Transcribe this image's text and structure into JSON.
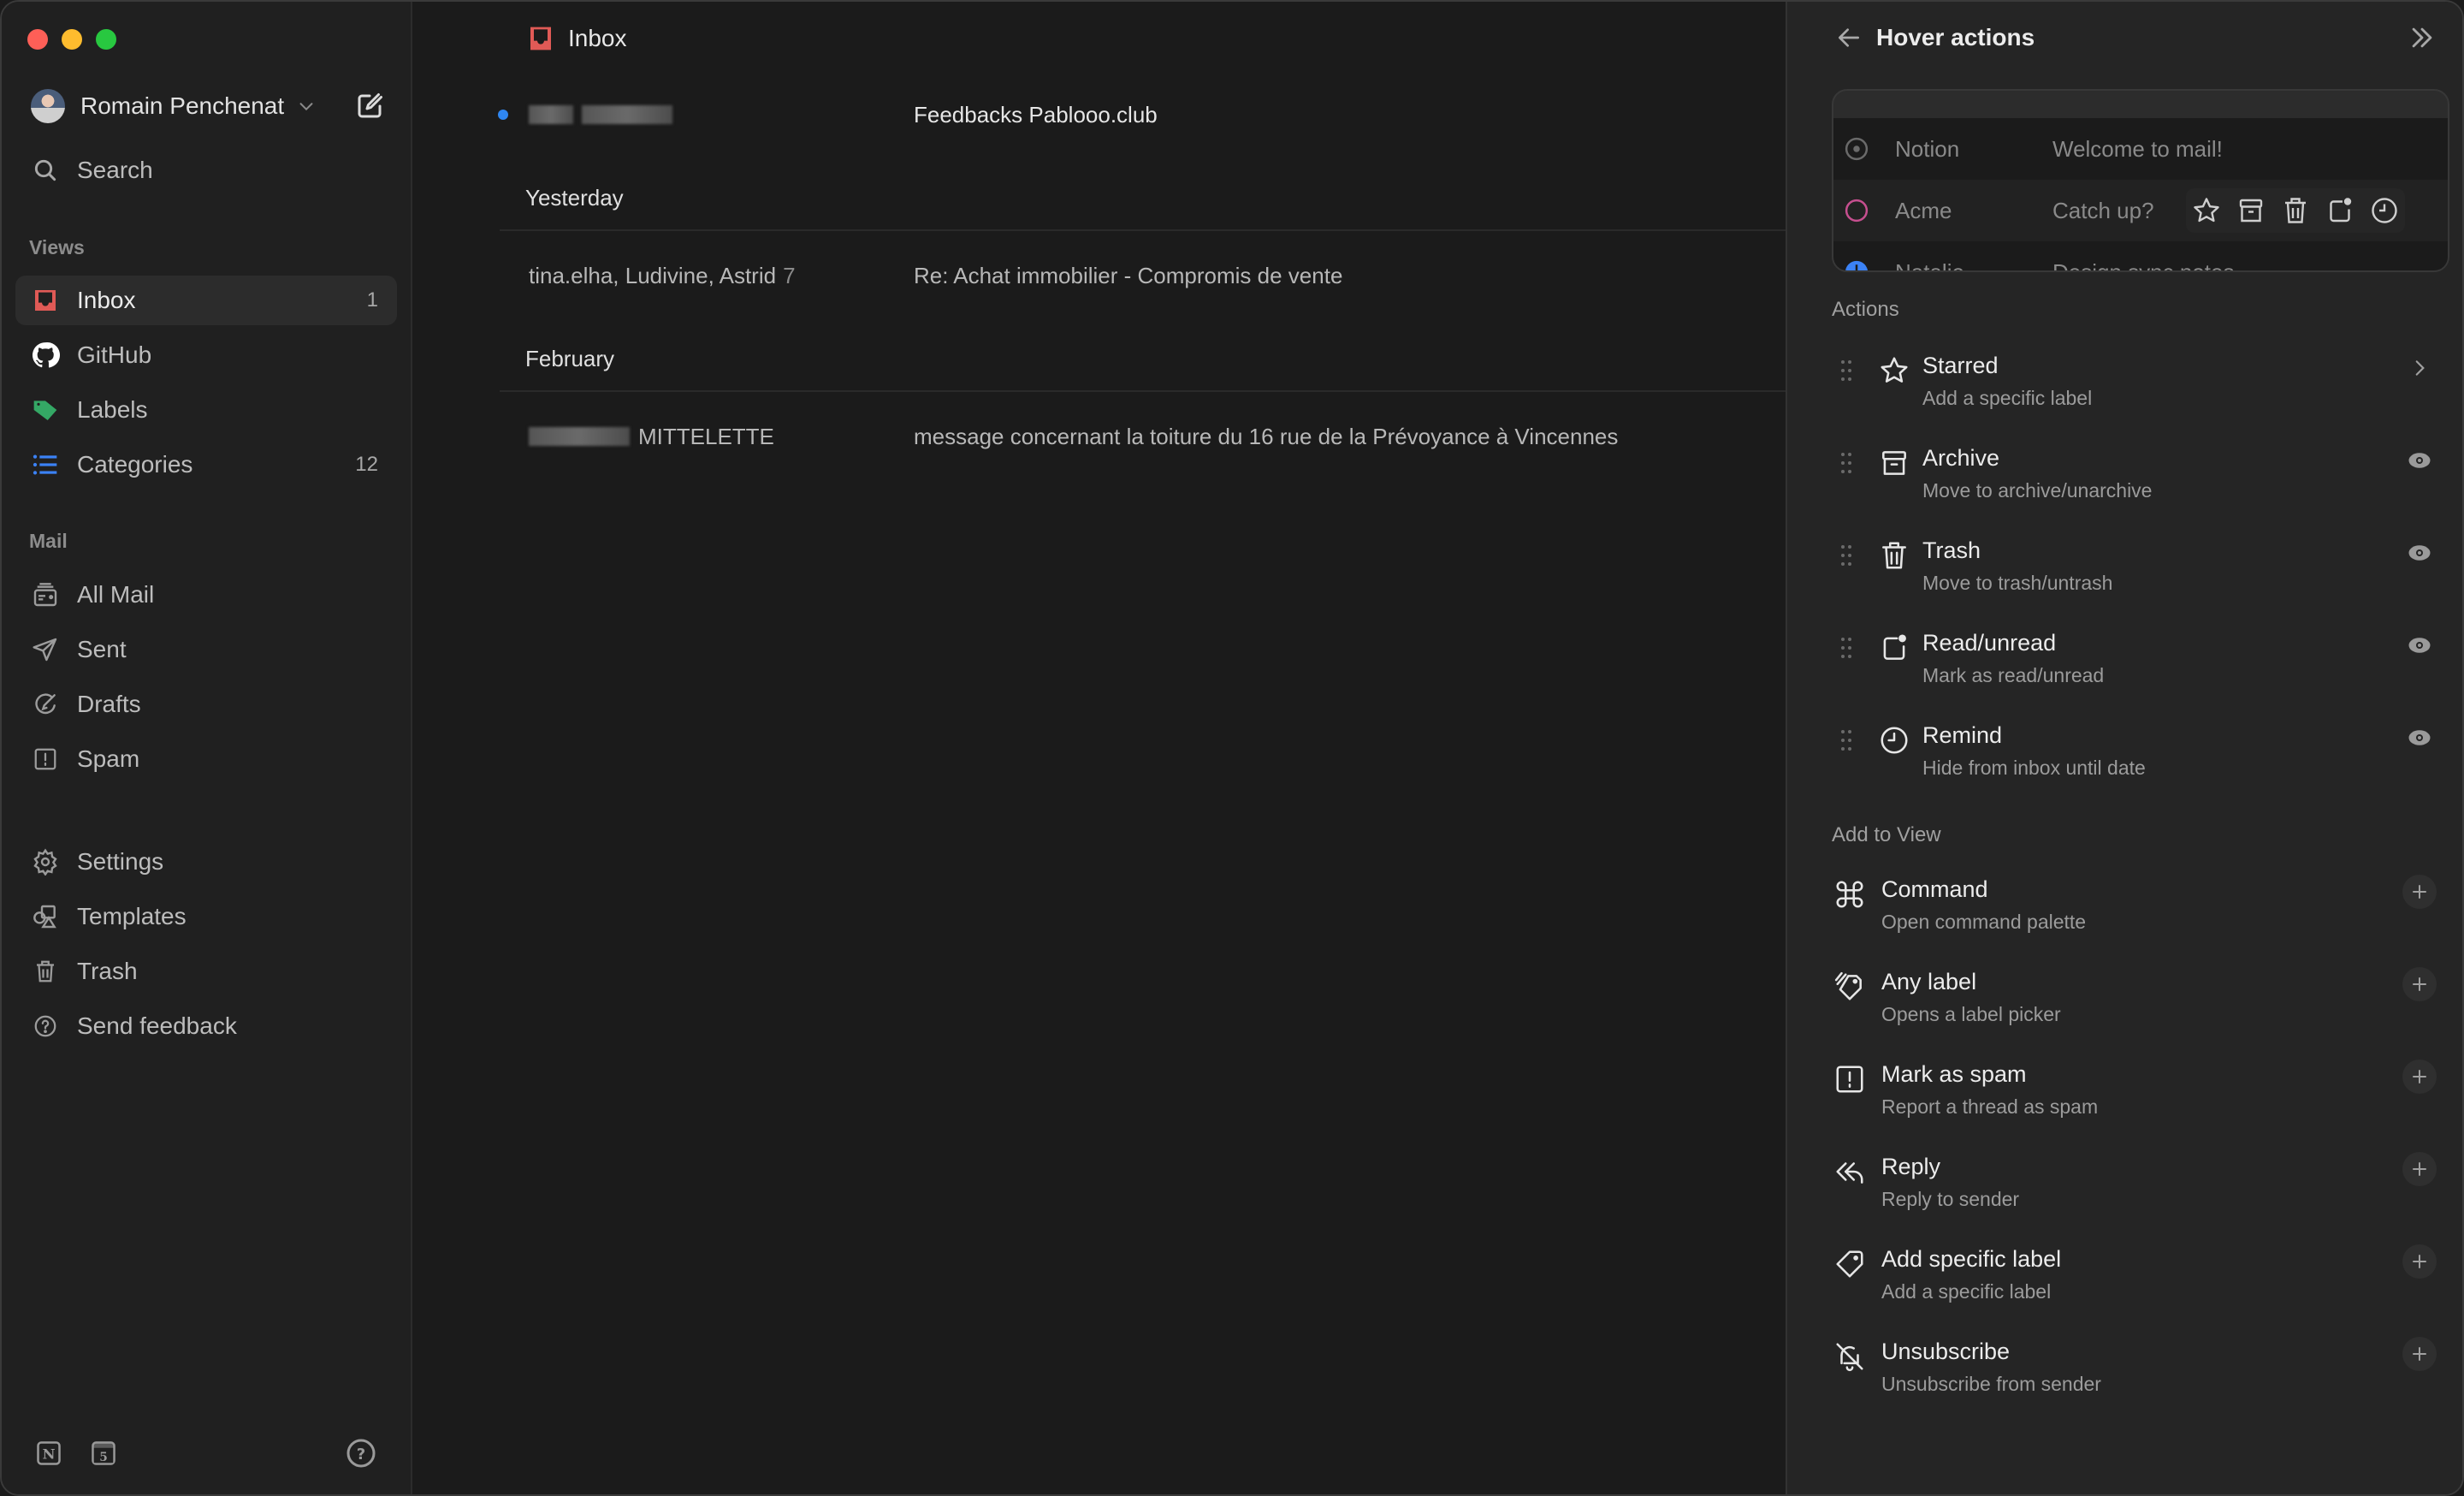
{
  "window": {
    "traffic_lights": [
      "close",
      "minimize",
      "maximize"
    ]
  },
  "sidebar": {
    "account": {
      "name": "Romain Penchenat",
      "avatar_icon": "avatar-photo",
      "dropdown_icon": "chevron-down-icon",
      "compose_icon": "compose-icon"
    },
    "search": {
      "label": "Search",
      "icon": "search-icon"
    },
    "views_label": "Views",
    "views": [
      {
        "label": "Inbox",
        "count": "1",
        "icon": "inbox-icon",
        "color": "#e05a56",
        "active": true
      },
      {
        "label": "GitHub",
        "count": "",
        "icon": "github-icon",
        "color": "#ffffff"
      },
      {
        "label": "Labels",
        "count": "",
        "icon": "tag-icon",
        "color": "#34a865"
      },
      {
        "label": "Categories",
        "count": "12",
        "icon": "list-icon",
        "color": "#3b82f6"
      }
    ],
    "mail_label": "Mail",
    "mail": [
      {
        "label": "All Mail",
        "icon": "all-mail-icon"
      },
      {
        "label": "Sent",
        "icon": "send-icon"
      },
      {
        "label": "Drafts",
        "icon": "drafts-icon"
      },
      {
        "label": "Spam",
        "icon": "spam-icon"
      }
    ],
    "footer_links": [
      {
        "label": "Settings",
        "icon": "gear-icon"
      },
      {
        "label": "Templates",
        "icon": "templates-icon"
      },
      {
        "label": "Trash",
        "icon": "trash-icon"
      },
      {
        "label": "Send feedback",
        "icon": "help-circle-icon"
      }
    ],
    "bottom": {
      "notion_glyph": "N",
      "calendar_glyph": "5",
      "help_glyph": "?"
    }
  },
  "main": {
    "title": "Inbox",
    "rows": [
      {
        "sender": "",
        "sender_redacted": true,
        "subject": "Feedbacks Pablooo.club",
        "unread": true
      }
    ],
    "groups": [
      {
        "label": "Yesterday",
        "rows": [
          {
            "sender": "tina.elha, Ludivine, Astrid",
            "count": "7",
            "subject": "Re: Achat immobilier - Compromis de vente"
          }
        ]
      },
      {
        "label": "February",
        "rows": [
          {
            "sender": "MITTELETTE",
            "sender_redacted_prefix": true,
            "subject": "message concernant la toiture du 16 rue de la Prévoyance à Vincennes"
          }
        ]
      }
    ]
  },
  "panel": {
    "title": "Hover actions",
    "back_icon": "arrow-left-icon",
    "collapse_icon": "chevrons-right-icon",
    "preview": [
      {
        "name": "Notion",
        "subject": "Welcome to mail!"
      },
      {
        "name": "Acme",
        "subject": "Catch up?"
      },
      {
        "name": "Natalie",
        "subject": "Design sync notes"
      }
    ],
    "actions_label": "Actions",
    "actions": [
      {
        "title": "Starred",
        "desc": "Add a specific label",
        "icon": "star-icon",
        "right": "chevron-right-icon"
      },
      {
        "title": "Archive",
        "desc": "Move to archive/unarchive",
        "icon": "archive-icon",
        "right": "eye-icon"
      },
      {
        "title": "Trash",
        "desc": "Move to trash/untrash",
        "icon": "trash-icon",
        "right": "eye-icon"
      },
      {
        "title": "Read/unread",
        "desc": "Mark as read/unread",
        "icon": "read-unread-icon",
        "right": "eye-icon"
      },
      {
        "title": "Remind",
        "desc": "Hide from inbox until date",
        "icon": "clock-icon",
        "right": "eye-icon"
      }
    ],
    "add_label": "Add to View",
    "add_items": [
      {
        "title": "Command",
        "desc": "Open command palette",
        "icon": "command-icon"
      },
      {
        "title": "Any label",
        "desc": "Opens a label picker",
        "icon": "tags-icon"
      },
      {
        "title": "Mark as spam",
        "desc": "Report a thread as spam",
        "icon": "spam-icon"
      },
      {
        "title": "Reply",
        "desc": "Reply to sender",
        "icon": "reply-icon"
      },
      {
        "title": "Add specific label",
        "desc": "Add a specific label",
        "icon": "tag-icon"
      },
      {
        "title": "Unsubscribe",
        "desc": "Unsubscribe from sender",
        "icon": "bell-off-icon"
      }
    ]
  }
}
